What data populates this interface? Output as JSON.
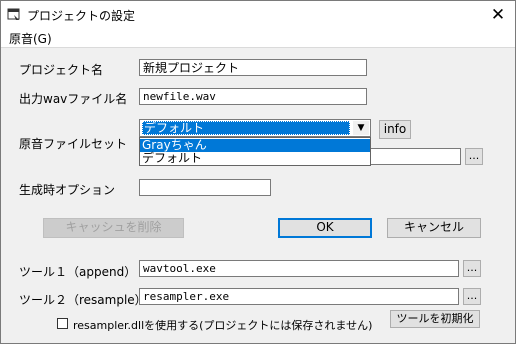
{
  "window": {
    "title": "プロジェクトの設定",
    "close_glyph": "✕"
  },
  "menu": {
    "items": [
      {
        "label": "原音(G)"
      }
    ]
  },
  "form": {
    "project_name": {
      "label": "プロジェクト名",
      "value": "新規プロジェクト"
    },
    "output_wav": {
      "label": "出力wavファイル名",
      "value": "newfile.wav"
    },
    "voicebank": {
      "label": "原音ファイルセット",
      "selected": "デフォルト",
      "options": [
        {
          "label": "Grayちゃん",
          "highlighted": true
        },
        {
          "label": "デフォルト",
          "highlighted": false
        }
      ],
      "info_button": "info",
      "path_value": "",
      "browse_label": "..."
    },
    "gen_options": {
      "label": "生成時オプション",
      "value": ""
    },
    "buttons": {
      "clear_cache": "キャッシュを削除",
      "ok": "OK",
      "cancel": "キャンセル"
    },
    "tool1": {
      "label": "ツール１（append）",
      "value": "wavtool.exe",
      "browse_label": "..."
    },
    "tool2": {
      "label": "ツール２（resample）",
      "value": "resampler.exe",
      "browse_label": "..."
    },
    "resampler_dll": {
      "label": "resampler.dllを使用する(プロジェクトには保存されません)",
      "checked": false
    },
    "init_tools_button": "ツールを初期化"
  },
  "colors": {
    "selection": "#0078d7",
    "dialog_bg": "#f0f0f0",
    "default_button_border": "#0078d7"
  }
}
